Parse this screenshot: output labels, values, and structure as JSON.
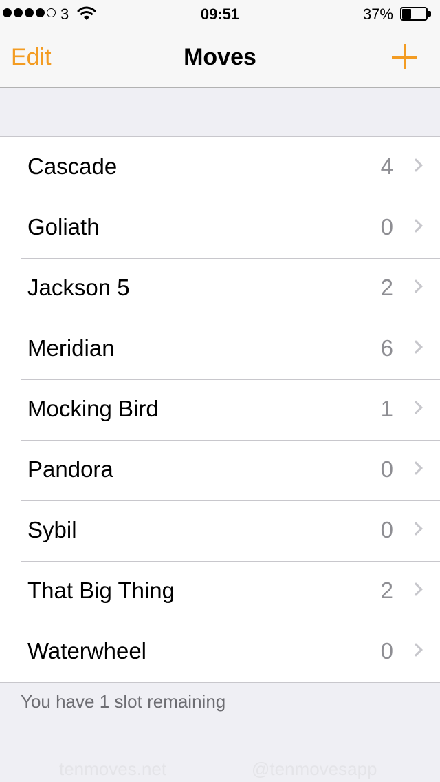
{
  "status_bar": {
    "carrier": "3",
    "time": "09:51",
    "battery_percent": "37%",
    "battery_level": 0.37,
    "signal_bars_filled": 4,
    "signal_bars_total": 5,
    "icons": [
      "signal-dots-icon",
      "wifi-icon",
      "battery-icon"
    ]
  },
  "nav": {
    "edit_label": "Edit",
    "title": "Moves",
    "add_icon": "plus-icon"
  },
  "colors": {
    "accent": "#f39c23",
    "count_gray": "#8e8e93",
    "background": "#efeff4"
  },
  "moves": [
    {
      "name": "Cascade",
      "count": "4"
    },
    {
      "name": "Goliath",
      "count": "0"
    },
    {
      "name": "Jackson 5",
      "count": "2"
    },
    {
      "name": "Meridian",
      "count": "6"
    },
    {
      "name": "Mocking Bird",
      "count": "1"
    },
    {
      "name": "Pandora",
      "count": "0"
    },
    {
      "name": "Sybil",
      "count": "0"
    },
    {
      "name": "That Big Thing",
      "count": "2"
    },
    {
      "name": "Waterwheel",
      "count": "0"
    }
  ],
  "footer": {
    "slots_text": "You have 1 slot remaining",
    "website": "tenmoves.net",
    "handle": "@tenmovesapp"
  }
}
